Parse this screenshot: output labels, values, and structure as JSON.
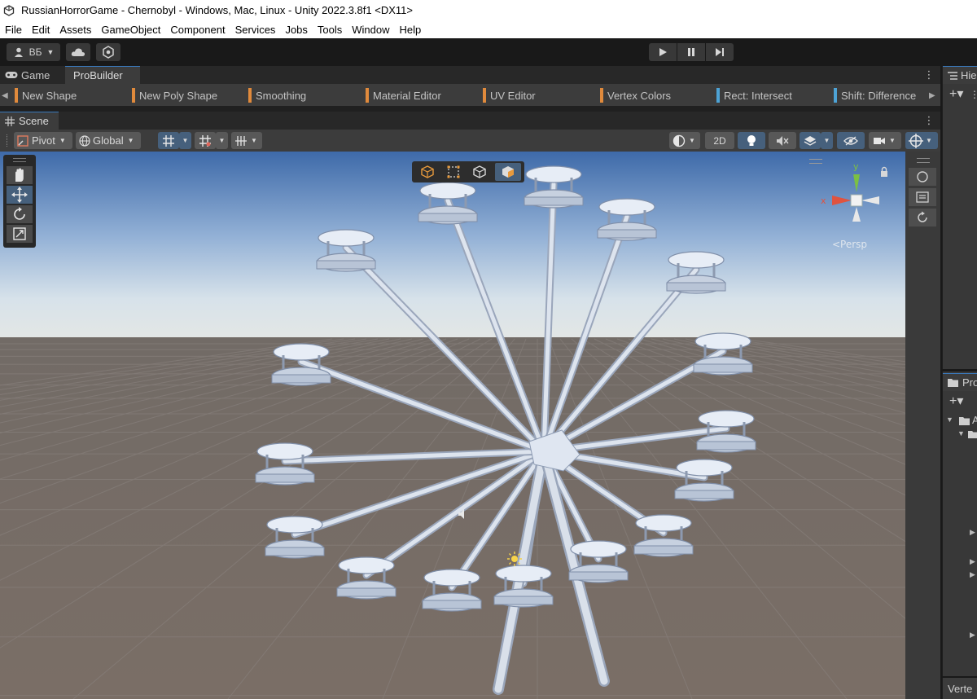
{
  "window": {
    "title": "RussianHorrorGame - Chernobyl - Windows, Mac, Linux - Unity 2022.3.8f1 <DX11>",
    "icon": "unity-logo-icon"
  },
  "menu": [
    "File",
    "Edit",
    "Assets",
    "GameObject",
    "Component",
    "Services",
    "Jobs",
    "Tools",
    "Window",
    "Help"
  ],
  "toolbar": {
    "account_label": "ВБ",
    "account_icon": "account-icon",
    "cloud_icon": "cloud-icon",
    "collab_icon": "collab-icon",
    "play_icon": "play-icon",
    "pause_icon": "pause-icon",
    "step_icon": "step-icon"
  },
  "tabs": {
    "game_label": "Game",
    "probuilder_label": "ProBuilder",
    "more": "⋮"
  },
  "probuilder": {
    "items": [
      {
        "label": "New Shape",
        "color": "#e08a3c"
      },
      {
        "label": "New Poly Shape",
        "color": "#e08a3c"
      },
      {
        "label": "Smoothing",
        "color": "#e08a3c"
      },
      {
        "label": "Material Editor",
        "color": "#e08a3c"
      },
      {
        "label": "UV Editor",
        "color": "#e08a3c"
      },
      {
        "label": "Vertex Colors",
        "color": "#e08a3c"
      },
      {
        "label": "Rect: Intersect",
        "color": "#4da3d6"
      },
      {
        "label": "Shift: Difference",
        "color": "#4da3d6"
      }
    ]
  },
  "scene": {
    "tab_label": "Scene",
    "more": "⋮",
    "pivot_label": "Pivot",
    "global_label": "Global",
    "mode_2d_label": "2D",
    "persp_label": "<Persp",
    "gizmo_y_label": "y",
    "gizmo_x_label": "x"
  },
  "hierarchy": {
    "tab_label": "Hie",
    "add_label": "+▾",
    "more": "⋮"
  },
  "project": {
    "tab_label": "Pro",
    "add_label": "+▾",
    "folder_label": "A"
  },
  "inspector": {
    "tab_label": "Verte"
  }
}
